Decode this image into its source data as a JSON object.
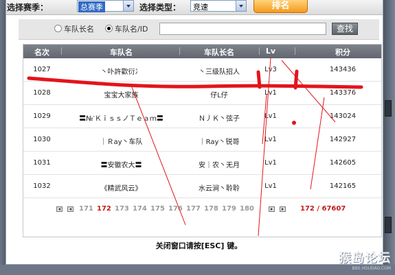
{
  "filters": {
    "season_label": "选择赛季：",
    "season_value": "总赛季",
    "type_label": "选择类型：",
    "type_value": "竞速",
    "rank_button": "排名"
  },
  "search": {
    "option_leader": "车队长名",
    "option_team": "车队名/ID",
    "selected": "车队名/ID",
    "input_value": "",
    "button": "查找"
  },
  "table": {
    "headers": [
      "名次",
      "车队名",
      "车队长名",
      "Lv",
      "积分"
    ],
    "rows": [
      {
        "rank": "1027",
        "team": "丶卟許歡衍冫",
        "leader": "丶三级队招人",
        "lv": "Lv3",
        "score": "143436"
      },
      {
        "rank": "1028",
        "team": "宝宝大家族",
        "leader": "仔L仔",
        "lv": "Lv1",
        "score": "143376"
      },
      {
        "rank": "1029",
        "team": "〓№′ＫｉｓｓノＴｅａｍ〓",
        "leader": "Ｎ丿Ｋ丶弦子",
        "lv": "Lv1",
        "score": "143024"
      },
      {
        "rank": "1030",
        "team": "｜Ｒay丶车队",
        "leader": "｜Ray丶锐哥",
        "lv": "Lv1",
        "score": "142927"
      },
      {
        "rank": "1031",
        "team": "〓安徽农大〓",
        "leader": "安｜农丶无月",
        "lv": "Lv1",
        "score": "142605"
      },
      {
        "rank": "1032",
        "team": "《精武风云》",
        "leader": "水云涧丶聆聆",
        "lv": "Lv1",
        "score": "142165"
      }
    ]
  },
  "pager": {
    "pages": [
      "171",
      "172",
      "173",
      "174",
      "175",
      "176",
      "177",
      "178",
      "179",
      "180"
    ],
    "current": "172",
    "summary": "172 / 67607"
  },
  "footer": {
    "text": "关闭窗口请按[ESC] 键。"
  },
  "watermark": {
    "name": "猴岛论坛",
    "url": "BBS.HOUDAO.COM"
  },
  "colors": {
    "annotation": "#e3141b",
    "header_bg": "#6e737b",
    "accent_orange": "#f59a1c",
    "current_page": "#c41a1a"
  }
}
